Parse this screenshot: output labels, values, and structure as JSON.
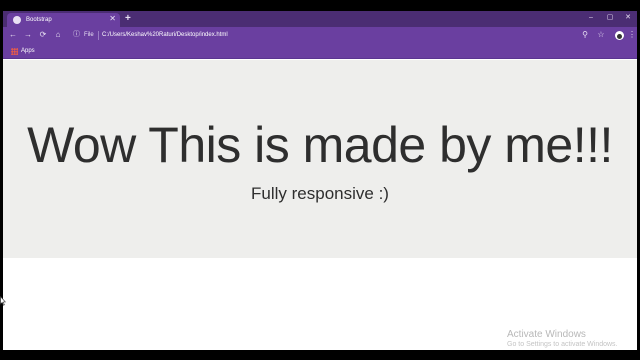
{
  "browser": {
    "tab": {
      "title": "Bootstrap",
      "close": "✕"
    },
    "new_tab": "+",
    "window_controls": {
      "minimize": "–",
      "maximize": "▢",
      "close": "✕"
    },
    "nav": {
      "back": "←",
      "forward": "→",
      "reload": "⟳",
      "home": "⌂"
    },
    "omnibox": {
      "info": "ⓘ",
      "scheme_label": "File",
      "url": "C:/Users/Keshav%20Raturi/Desktop/index.html"
    },
    "toolbar_right": {
      "search": "⚲",
      "star": "☆",
      "menu": "⋮"
    },
    "bookmarks": [
      {
        "label": "Apps"
      }
    ],
    "accent_colors": {
      "tabstrip": "#4b2d73",
      "toolbar": "#6a3fa0"
    }
  },
  "page": {
    "headline": "Wow This is made by me!!!",
    "subline": "Fully responsive :)",
    "jumbotron_bg": "#eeeeec"
  },
  "os_overlay": {
    "title": "Activate Windows",
    "subtitle": "Go to Settings to activate Windows."
  }
}
